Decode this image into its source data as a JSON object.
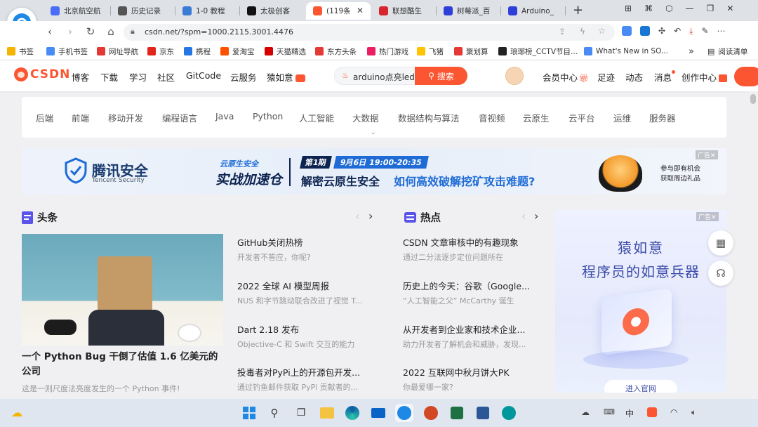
{
  "browser": {
    "tabs": [
      {
        "label": "北京航空航",
        "color": "#4a6cf7"
      },
      {
        "label": "历史记录",
        "color": "#555555"
      },
      {
        "label": "1-0 教程",
        "color": "#3a7bd5"
      },
      {
        "label": "太极创客",
        "color": "#111111"
      },
      {
        "label": "(119条",
        "color": "#fc5531",
        "active": true
      },
      {
        "label": "联想酷生",
        "color": "#d8252b"
      },
      {
        "label": "树莓派_百",
        "color": "#2e3ed8"
      },
      {
        "label": "Arduino_",
        "color": "#2e3ed8"
      }
    ],
    "new_tab": "+",
    "close_tab": "✕",
    "url": "csdn.net/?spm=1000.2115.3001.4476"
  },
  "bookmarks": [
    {
      "label": "书签",
      "color": "#f5b400"
    },
    {
      "label": "手机书签",
      "color": "#4a8af4"
    },
    {
      "label": "网址导航",
      "color": "#e53935"
    },
    {
      "label": "京东",
      "color": "#e1251b"
    },
    {
      "label": "携程",
      "color": "#2577e3"
    },
    {
      "label": "爱淘宝",
      "color": "#ff5000"
    },
    {
      "label": "天猫精选",
      "color": "#d40000"
    },
    {
      "label": "东方头条",
      "color": "#e53935"
    },
    {
      "label": "热门游戏",
      "color": "#e91e63"
    },
    {
      "label": "飞猪",
      "color": "#ffc300"
    },
    {
      "label": "聚划算",
      "color": "#e53935"
    },
    {
      "label": "琅琊榜_CCTV节目...",
      "color": "#222222"
    },
    {
      "label": "What's New in SO...",
      "color": "#4a8af4"
    }
  ],
  "bookmarks_more": "»",
  "reading_list": "阅读清单",
  "csdn": {
    "logo": "CSDN",
    "nav": [
      "博客",
      "下载",
      "学习",
      "社区",
      "GitCode",
      "云服务",
      "猿如意"
    ],
    "search_value": "arduino点亮led",
    "search_button": "搜索",
    "user_nav": [
      "会员中心",
      "足迹",
      "动态",
      "消息",
      "创作中心"
    ],
    "categories": [
      "后端",
      "前端",
      "移动开发",
      "编程语言",
      "Java",
      "Python",
      "人工智能",
      "大数据",
      "数据结构与算法",
      "音视频",
      "云原生",
      "云平台",
      "运维",
      "服务器"
    ]
  },
  "banner": {
    "brand": "腾讯安全",
    "brand_en": "Tencent Security",
    "event_badge": "云原生安全",
    "event_title": "实战加速仓",
    "issue": "第1期",
    "date": "9月6日 19:00-20:35",
    "headline_a": "解密云原生安全",
    "headline_b": "如何高效破解挖矿攻击难题?",
    "side_note_1": "参与即有机会",
    "side_note_2": "获取周边礼品",
    "ad_tag": "广告✕"
  },
  "headlines": {
    "title": "头条",
    "feature_title": "一个 Python Bug 干倒了估值 1.6 亿美元的公司",
    "feature_sub": "这是一则尺度法亮度发生的一个 Python 事件!",
    "items": [
      {
        "title": "GitHub关闭热榜",
        "sub": "开发者不答应，你呢?"
      },
      {
        "title": "2022 全球 AI 模型周报",
        "sub": "NUS 和字节跳动联合改进了视觉 T..."
      },
      {
        "title": "Dart 2.18 发布",
        "sub": "Objective-C 和 Swift 交互的能力"
      },
      {
        "title": "投毒者对PyPi上的开源包开发...",
        "sub": "通过钓鱼邮件获取 PyPi 贡献者的..."
      }
    ]
  },
  "hot": {
    "title": "热点",
    "items": [
      {
        "title": "CSDN 文章审核中的有趣现象",
        "sub": "通过二分法逐步定位问题所在"
      },
      {
        "title": "历史上的今天：谷歌（Google...",
        "sub": "“人工智能之父” McCarthy 诞生"
      },
      {
        "title": "从开发者到企业家和技术企业...",
        "sub": "助力开发者了解机会和威胁，发现..."
      },
      {
        "title": "2022 互联网中秋月饼大PK",
        "sub": "你最爱哪一家?"
      }
    ]
  },
  "ad_panel": {
    "tag": "广告✕",
    "line1": "猿如意",
    "line2": "程序员的如意兵器",
    "cta": "进入官网"
  },
  "taskbar": {
    "ime": "中"
  }
}
